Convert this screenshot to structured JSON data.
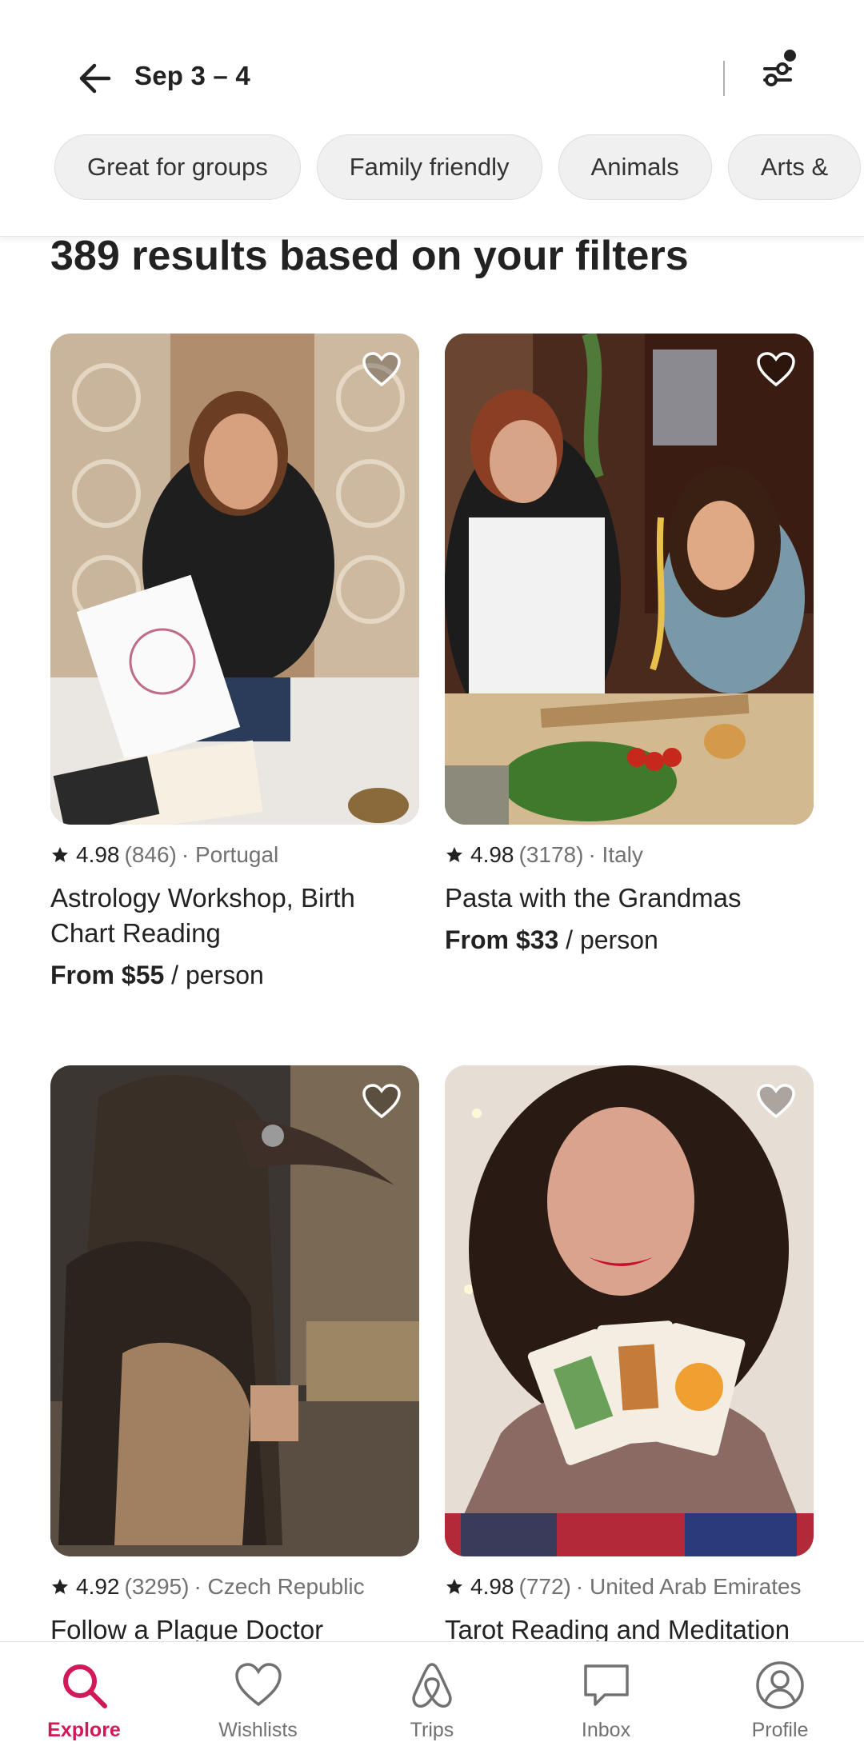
{
  "header": {
    "date_range": "Sep 3 – 4",
    "back_icon": "arrow-left-icon",
    "filter_icon": "filter-sliders-icon"
  },
  "chips": [
    "Great for groups",
    "Family friendly",
    "Animals",
    "Arts &"
  ],
  "results_title": "389 results based on your filters",
  "listings": [
    {
      "rating": "4.98",
      "reviews": "(846)",
      "location": "· Portugal",
      "title": "Astrology Workshop, Birth Chart Reading",
      "price_bold": "From $55",
      "price_unit": " / person"
    },
    {
      "rating": "4.98",
      "reviews": "(3178)",
      "location": "· Italy",
      "title": "Pasta with the Grandmas",
      "price_bold": "From $33",
      "price_unit": " / person"
    },
    {
      "rating": "4.92",
      "reviews": "(3295)",
      "location": "· Czech Republic",
      "title": "Follow a Plague Doctor"
    },
    {
      "rating": "4.98",
      "reviews": "(772)",
      "location": "· United Arab Emirates",
      "title": "Tarot Reading and Meditation"
    }
  ],
  "nav": [
    {
      "label": "Explore",
      "icon": "search-icon",
      "active": true
    },
    {
      "label": "Wishlists",
      "icon": "heart-icon"
    },
    {
      "label": "Trips",
      "icon": "airbnb-logo-icon"
    },
    {
      "label": "Inbox",
      "icon": "chat-bubble-icon"
    },
    {
      "label": "Profile",
      "icon": "user-circle-icon"
    }
  ],
  "colors": {
    "accent": "#d3185a",
    "text": "#222222",
    "muted": "#717171"
  }
}
